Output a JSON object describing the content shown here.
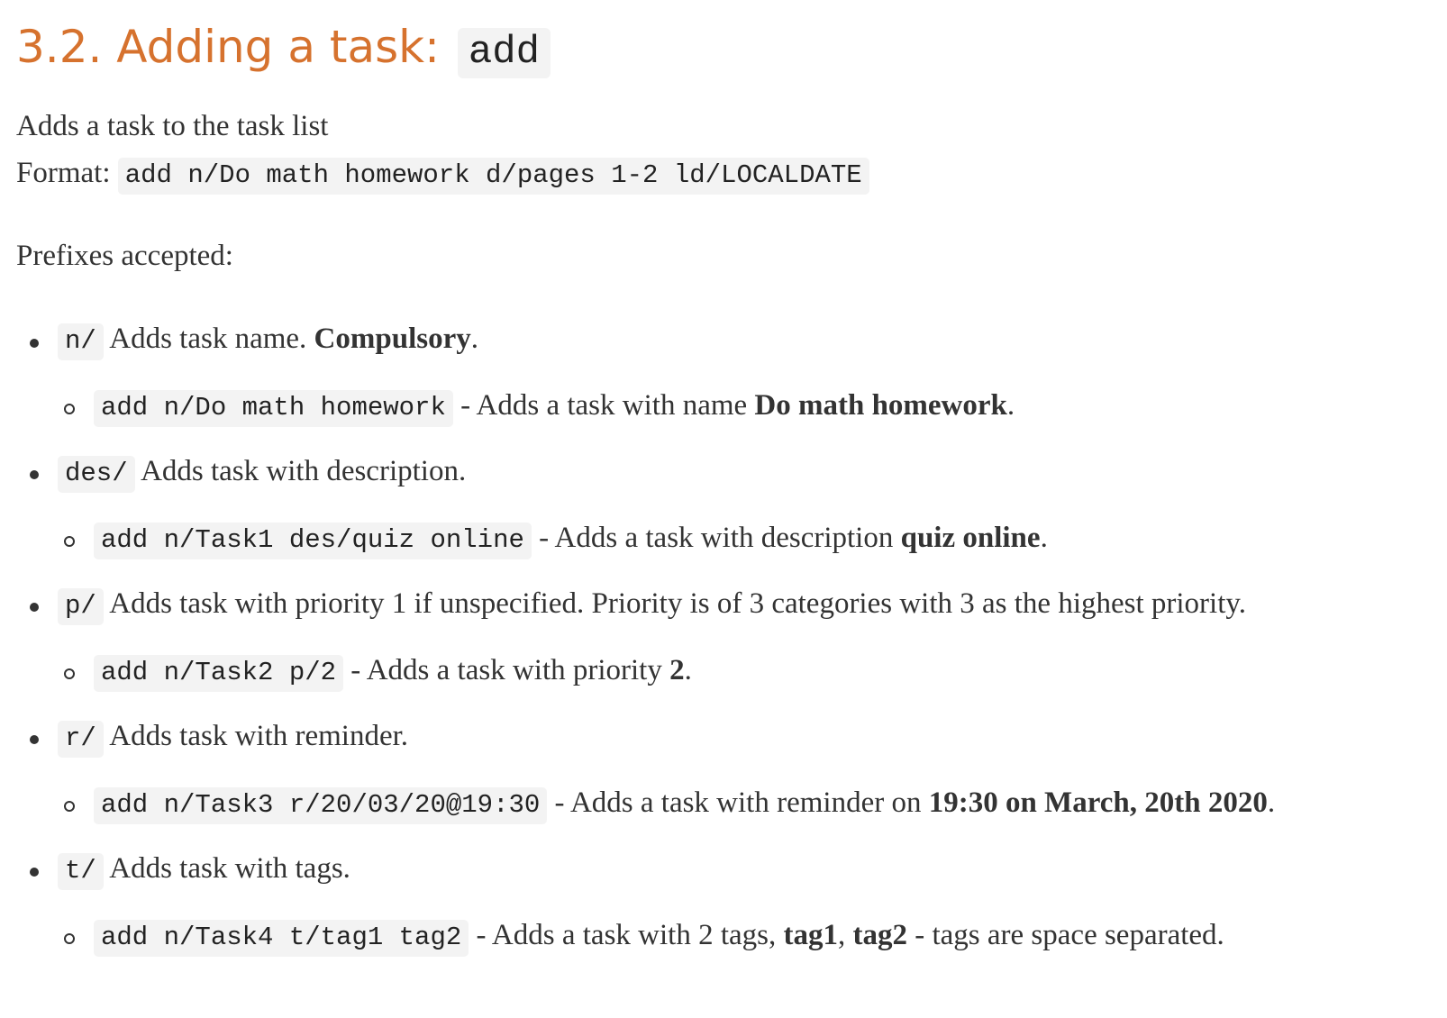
{
  "heading": {
    "text": "3.2. Adding a task:",
    "code": "add"
  },
  "intro": "Adds a task to the task list",
  "format": {
    "label": "Format:",
    "code": "add n/Do math homework d/pages 1-2 ld/LOCALDATE"
  },
  "prefixes_label": "Prefixes accepted:",
  "prefixes": [
    {
      "code": "n/",
      "text": "Adds task name.",
      "bold": "Compulsory",
      "tail": ".",
      "example": {
        "code": "add n/Do math homework",
        "text": "- Adds a task with name",
        "bold": "Do math homework",
        "tail": "."
      }
    },
    {
      "code": "des/",
      "text": "Adds task with description.",
      "example": {
        "code": "add n/Task1 des/quiz online",
        "text": "- Adds a task with description",
        "bold": "quiz online",
        "tail": "."
      }
    },
    {
      "code": "p/",
      "text": "Adds task with priority 1 if unspecified. Priority is of 3 categories with 3 as the highest priority.",
      "example": {
        "code": "add n/Task2 p/2",
        "text": "- Adds a task with priority",
        "bold": "2",
        "tail": "."
      }
    },
    {
      "code": "r/",
      "text": "Adds task with reminder.",
      "example": {
        "code": "add n/Task3 r/20/03/20@19:30",
        "text": "- Adds a task with reminder on",
        "bold": "19:30 on March, 20th 2020",
        "tail": "."
      }
    },
    {
      "code": "t/",
      "text": "Adds task with tags.",
      "example": {
        "code": "add n/Task4 t/tag1 tag2",
        "text": "- Adds a task with 2 tags,",
        "bold": "tag1",
        "sep": ",",
        "bold2": "tag2",
        "tail": "- tags are space separated."
      }
    }
  ]
}
